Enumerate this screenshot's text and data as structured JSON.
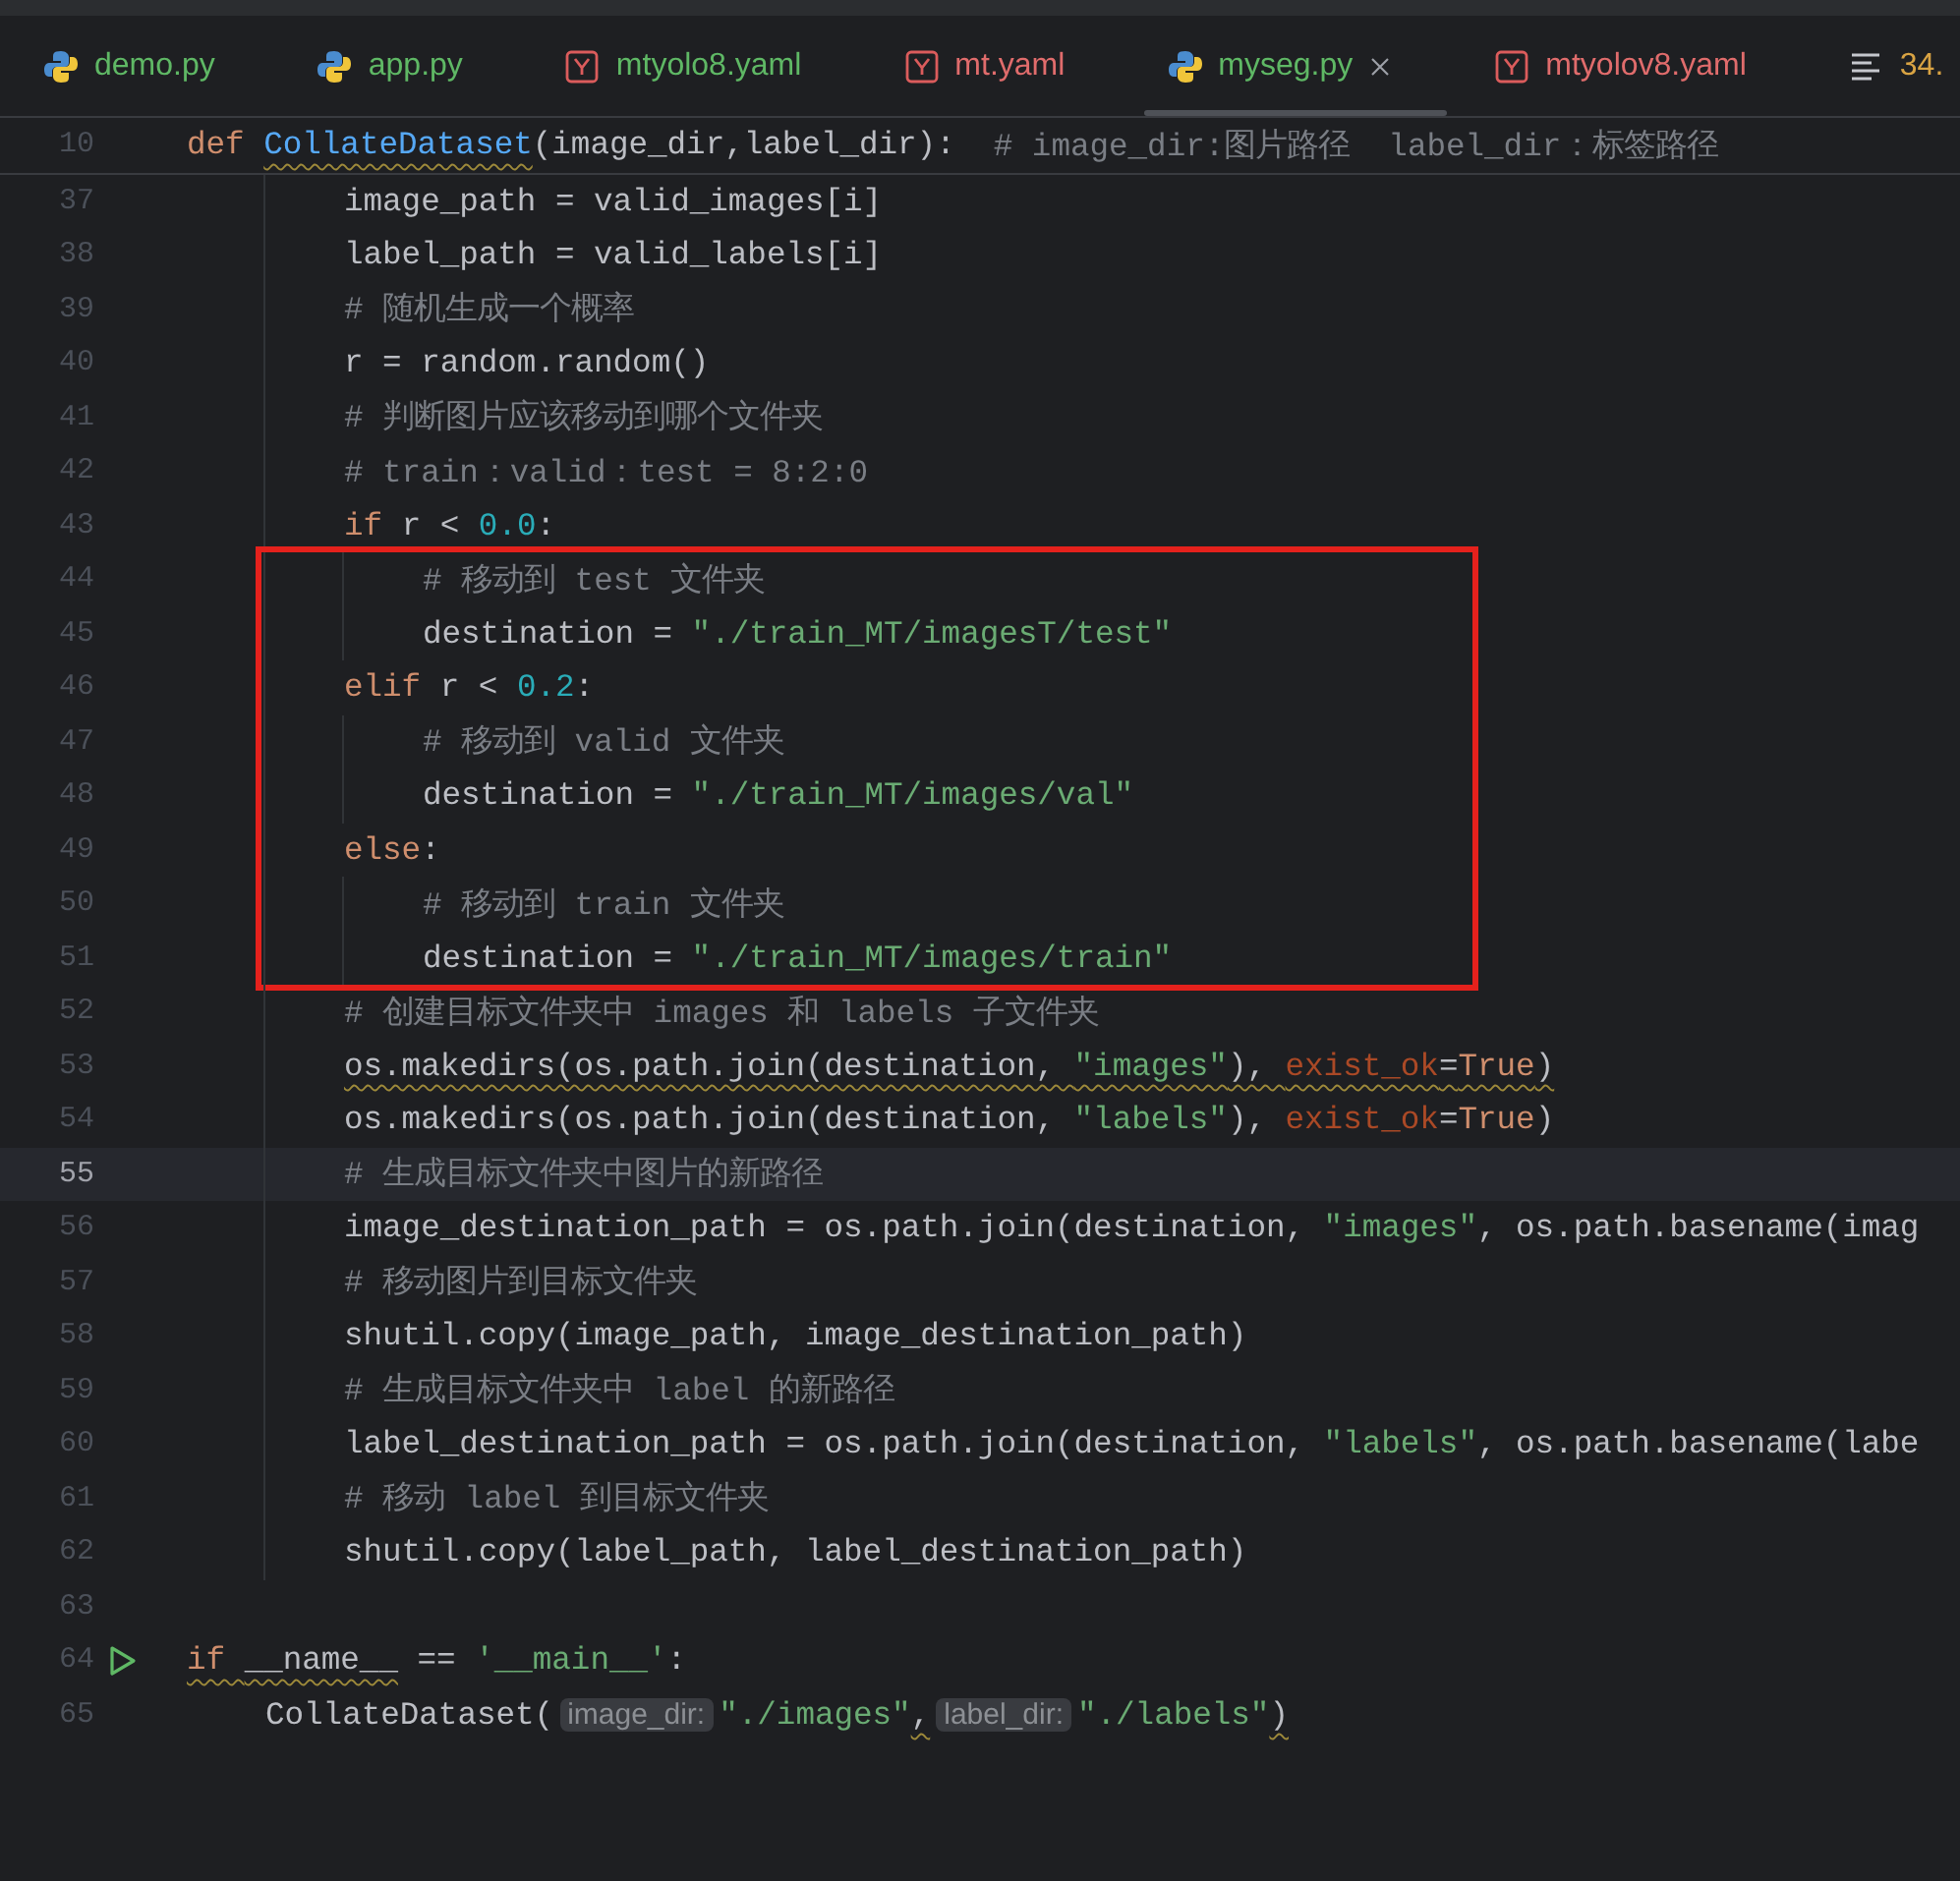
{
  "tabs": [
    {
      "label": "demo.py",
      "kind": "python",
      "color": "#5fb865",
      "selected": false,
      "closable": false
    },
    {
      "label": "app.py",
      "kind": "python",
      "color": "#5fb865",
      "selected": false,
      "closable": false
    },
    {
      "label": "mtyolo8.yaml",
      "kind": "yaml",
      "color": "#5fb865",
      "selected": false,
      "closable": false
    },
    {
      "label": "mt.yaml",
      "kind": "yaml",
      "color": "#e06c6c",
      "selected": false,
      "closable": false
    },
    {
      "label": "myseg.py",
      "kind": "python",
      "color": "#5fb865",
      "selected": true,
      "closable": true
    },
    {
      "label": "mtyolov8.yaml",
      "kind": "yaml",
      "color": "#e06c6c",
      "selected": false,
      "closable": false
    },
    {
      "label": "34.",
      "kind": "text",
      "color": "#d9a343",
      "selected": false,
      "closable": false
    }
  ],
  "editor": {
    "sticky_line": {
      "number": "10",
      "tokens": [
        {
          "kind": "kw",
          "text": "def "
        },
        {
          "kind": "fn",
          "text": "CollateDataset",
          "warning": true
        },
        {
          "kind": "plain",
          "text": "(image_dir,label_dir):  "
        },
        {
          "kind": "cmt",
          "text": "# image_dir:图片路径  label_dir：标签路径"
        }
      ],
      "children": [
        {
          "number": "37",
          "tokens": [
            {
              "kind": "plain",
              "text": "image_path = valid_images[i]"
            }
          ]
        },
        {
          "number": "38",
          "tokens": [
            {
              "kind": "plain",
              "text": "label_path = valid_labels[i]"
            }
          ]
        },
        {
          "number": "39",
          "tokens": [
            {
              "kind": "cmt",
              "text": "# 随机生成一个概率"
            }
          ]
        },
        {
          "number": "40",
          "tokens": [
            {
              "kind": "plain",
              "text": "r = random.random()"
            }
          ]
        },
        {
          "number": "41",
          "tokens": [
            {
              "kind": "cmt",
              "text": "# 判断图片应该移动到哪个文件夹"
            }
          ]
        },
        {
          "number": "42",
          "tokens": [
            {
              "kind": "cmt",
              "text": "# train：valid：test = 8:2:0"
            }
          ]
        },
        {
          "number": "43",
          "tokens": [
            {
              "kind": "kw",
              "text": "if "
            },
            {
              "kind": "plain",
              "text": "r < "
            },
            {
              "kind": "num",
              "text": "0.0"
            },
            {
              "kind": "plain",
              "text": ":"
            }
          ],
          "children": [
            {
              "number": "44",
              "framed": true,
              "tokens": [
                {
                  "kind": "cmt",
                  "text": "# 移动到 test 文件夹"
                }
              ]
            },
            {
              "number": "45",
              "framed": true,
              "tokens": [
                {
                  "kind": "plain",
                  "text": "destination = "
                },
                {
                  "kind": "str",
                  "text": "\"./train_MT/imagesT/test\""
                }
              ]
            }
          ]
        },
        {
          "number": "46",
          "framed": true,
          "tokens": [
            {
              "kind": "kw",
              "text": "elif "
            },
            {
              "kind": "plain",
              "text": "r < "
            },
            {
              "kind": "num",
              "text": "0.2"
            },
            {
              "kind": "plain",
              "text": ":"
            }
          ],
          "children": [
            {
              "number": "47",
              "framed": true,
              "tokens": [
                {
                  "kind": "cmt",
                  "text": "# 移动到 valid 文件夹"
                }
              ]
            },
            {
              "number": "48",
              "framed": true,
              "tokens": [
                {
                  "kind": "plain",
                  "text": "destination = "
                },
                {
                  "kind": "str",
                  "text": "\"./train_MT/images/val\""
                }
              ]
            }
          ]
        },
        {
          "number": "49",
          "framed": true,
          "tokens": [
            {
              "kind": "kw",
              "text": "else"
            },
            {
              "kind": "plain",
              "text": ":"
            }
          ],
          "children": [
            {
              "number": "50",
              "framed": true,
              "tokens": [
                {
                  "kind": "cmt",
                  "text": "# 移动到 train 文件夹"
                }
              ]
            },
            {
              "number": "51",
              "framed": true,
              "tokens": [
                {
                  "kind": "plain",
                  "text": "destination = "
                },
                {
                  "kind": "str",
                  "text": "\"./train_MT/images/train\""
                }
              ]
            }
          ]
        },
        {
          "number": "52",
          "tokens": [
            {
              "kind": "cmt",
              "text": "# 创建目标文件夹中 images 和 labels 子文件夹"
            }
          ]
        },
        {
          "number": "53",
          "tokens": [
            {
              "kind": "plain",
              "text": "os.makedirs(os.path.join(destination, ",
              "warning": true
            },
            {
              "kind": "str",
              "text": "\"images\"",
              "warning": true
            },
            {
              "kind": "plain",
              "text": "), ",
              "warning": true
            },
            {
              "kind": "param",
              "text": "exist_ok",
              "warning": true
            },
            {
              "kind": "plain",
              "text": "=",
              "warning": true
            },
            {
              "kind": "kw",
              "text": "True",
              "warning": true
            },
            {
              "kind": "plain",
              "text": ")",
              "warning": true
            }
          ]
        },
        {
          "number": "54",
          "tokens": [
            {
              "kind": "plain",
              "text": "os.makedirs(os.path.join(destination, "
            },
            {
              "kind": "str",
              "text": "\"labels\""
            },
            {
              "kind": "plain",
              "text": "), "
            },
            {
              "kind": "param",
              "text": "exist_ok"
            },
            {
              "kind": "plain",
              "text": "="
            },
            {
              "kind": "kw",
              "text": "True"
            },
            {
              "kind": "plain",
              "text": ")"
            }
          ]
        },
        {
          "number": "55",
          "current": true,
          "tokens": [
            {
              "kind": "cmt",
              "text": "# 生成目标文件夹中图片的新路径"
            }
          ]
        },
        {
          "number": "56",
          "tokens": [
            {
              "kind": "plain",
              "text": "image_destination_path = os.path.join(destination, "
            },
            {
              "kind": "str",
              "text": "\"images\""
            },
            {
              "kind": "plain",
              "text": ", os.path.basename(imag"
            }
          ]
        },
        {
          "number": "57",
          "tokens": [
            {
              "kind": "cmt",
              "text": "# 移动图片到目标文件夹"
            }
          ]
        },
        {
          "number": "58",
          "tokens": [
            {
              "kind": "plain",
              "text": "shutil.copy(image_path, image_destination_path)"
            }
          ]
        },
        {
          "number": "59",
          "tokens": [
            {
              "kind": "cmt",
              "text": "# 生成目标文件夹中 label 的新路径"
            }
          ]
        },
        {
          "number": "60",
          "tokens": [
            {
              "kind": "plain",
              "text": "label_destination_path = os.path.join(destination, "
            },
            {
              "kind": "str",
              "text": "\"labels\""
            },
            {
              "kind": "plain",
              "text": ", os.path.basename(labe"
            }
          ]
        },
        {
          "number": "61",
          "tokens": [
            {
              "kind": "cmt",
              "text": "# 移动 label 到目标文件夹"
            }
          ]
        },
        {
          "number": "62",
          "tokens": [
            {
              "kind": "plain",
              "text": "shutil.copy(label_path, label_destination_path)"
            }
          ]
        }
      ]
    },
    "lines": [
      {
        "number": "63"
      },
      {
        "number": "64",
        "runnable": true,
        "tokens": [
          {
            "kind": "kw",
            "text": "if ",
            "warning": true
          },
          {
            "kind": "plain",
            "text": "__name__",
            "warning": true
          },
          {
            "kind": "plain",
            "text": " == "
          },
          {
            "kind": "str",
            "text": "'__main__'"
          },
          {
            "kind": "plain",
            "text": ":"
          }
        ],
        "children": [
          {
            "number": "65",
            "tokens": [
              {
                "kind": "plain",
                "text": "CollateDataset("
              },
              {
                "kind": "hint",
                "text": "image_dir:"
              },
              {
                "kind": "str",
                "text": "\"./images\""
              },
              {
                "kind": "plain",
                "text": ",",
                "warning": true
              },
              {
                "kind": "hint",
                "text": "label_dir:"
              },
              {
                "kind": "str",
                "text": "\"./labels\""
              },
              {
                "kind": "plain",
                "text": ")",
                "warning": true
              }
            ]
          }
        ]
      }
    ]
  }
}
